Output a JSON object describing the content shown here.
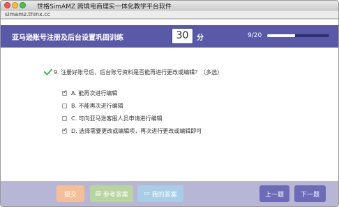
{
  "window": {
    "title": "世格SimAMZ 跨境电商理实一体化教学平台软件",
    "url": "simamz.thinx.cc"
  },
  "header": {
    "title": "亚马逊账号注册及后台设置巩固训练",
    "timer_value": "30",
    "timer_unit": "分",
    "progress_text": "9/20",
    "progress_fraction": 0.45
  },
  "question": {
    "text": "9. 注册好账号后，后台账号资料是否能再进行更改或编辑？（多选）",
    "options": [
      {
        "label": "A. 能再次进行编辑",
        "checked": true
      },
      {
        "label": "B. 不能再次进行编辑",
        "checked": false
      },
      {
        "label": "C. 可向亚马逊客服人员申请进行编辑",
        "checked": false
      },
      {
        "label": "D. 选择需要更改或编辑项，再次进行更改或编辑即可",
        "checked": true
      }
    ]
  },
  "footer": {
    "submit_label": "提交",
    "reference_label": "参考答案",
    "my_answer_label": "我的答案",
    "prev_label": "上一题",
    "next_label": "下一题"
  },
  "colors": {
    "header_bg": "#5a59a8",
    "footer_bg": "#b7b6d4",
    "submit_bg": "#f4bf98",
    "reference_bg": "#b8d59f",
    "my_answer_bg": "#a9cde6",
    "nav_bg": "#6d6ab7",
    "correct_check": "#4caf50"
  }
}
